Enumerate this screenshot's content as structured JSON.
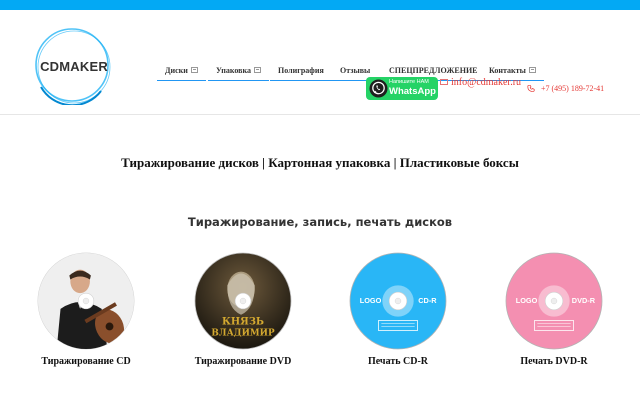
{
  "colors": {
    "accent": "#03a9f4",
    "nav_underline": "#2196f3",
    "contact_red": "#e53935",
    "whatsapp_green": "#25d366",
    "cdr_blue": "#29b6f6",
    "dvdr_pink": "#f48fb1"
  },
  "header": {
    "logo_text": "CDMAKER",
    "nav": [
      {
        "label": "Диски",
        "has_submenu": true
      },
      {
        "label": "Упаковка",
        "has_submenu": true
      },
      {
        "label": "Полиграфия",
        "has_submenu": false
      },
      {
        "label": "Отзывы",
        "has_submenu": false
      },
      {
        "label": "СПЕЦПРЕДЛОЖЕНИЕ",
        "has_submenu": false
      },
      {
        "label": "Контакты",
        "has_submenu": true
      }
    ],
    "email": "info@cdmaker.ru",
    "phone": "+7 (495) 189-72-41",
    "whatsapp": {
      "small": "Напишите НАМ",
      "big": "WhatsApp",
      "icon": "whatsapp-icon"
    }
  },
  "main": {
    "headline": "Тиражирование дисков | Картонная упаковка | Пластиковые боксы",
    "subhead": "Тиражирование, запись, печать дисков",
    "products": [
      {
        "caption": "Тиражирование CD",
        "art": "guitarist-photo"
      },
      {
        "caption": "Тиражирование DVD",
        "art": "film-poster",
        "art_text": [
          "КНЯЗЬ",
          "ВЛАДИМИР"
        ]
      },
      {
        "caption": "Печать CD-R",
        "art": "blank-disc",
        "logo": "LOGO",
        "format": "CD-R"
      },
      {
        "caption": "Печать DVD-R",
        "art": "blank-disc",
        "logo": "LOGO",
        "format": "DVD-R"
      }
    ]
  }
}
